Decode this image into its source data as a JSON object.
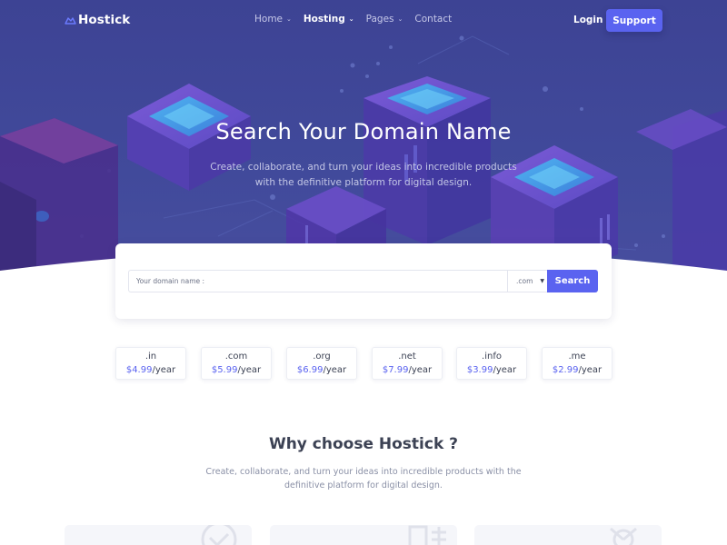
{
  "nav": {
    "logo": "Hostick",
    "menu": [
      {
        "label": "Home",
        "has_dropdown": true,
        "active": false
      },
      {
        "label": "Hosting",
        "has_dropdown": true,
        "active": true
      },
      {
        "label": "Pages",
        "has_dropdown": true,
        "active": false
      },
      {
        "label": "Contact",
        "has_dropdown": false,
        "active": false
      }
    ],
    "login": "Login",
    "support": "Support"
  },
  "hero": {
    "title": "Search Your Domain Name",
    "subtitle": "Create, collaborate, and turn your ideas into incredible products with the definitive platform for digital design."
  },
  "search": {
    "placeholder": "Your domain name :",
    "tld_selected": ".com",
    "button": "Search"
  },
  "prices": [
    {
      "tld": ".in",
      "amount": "$4.99",
      "period": "/year"
    },
    {
      "tld": ".com",
      "amount": "$5.99",
      "period": "/year"
    },
    {
      "tld": ".org",
      "amount": "$6.99",
      "period": "/year"
    },
    {
      "tld": ".net",
      "amount": "$7.99",
      "period": "/year"
    },
    {
      "tld": ".info",
      "amount": "$3.99",
      "period": "/year"
    },
    {
      "tld": ".me",
      "amount": "$2.99",
      "period": "/year"
    }
  ],
  "why": {
    "title": "Why choose Hostick ?",
    "subtitle": "Create, collaborate, and turn your ideas into incredible products with the definitive platform for digital design."
  },
  "colors": {
    "primary": "#5a63f0",
    "hero_bg": "#414a9b",
    "heading": "#3c4254",
    "muted": "#8a90a6"
  },
  "icons": [
    "cloud-logo-icon",
    "chevron-down-icon",
    "check-circle-icon",
    "server-icon",
    "settings-icon"
  ]
}
